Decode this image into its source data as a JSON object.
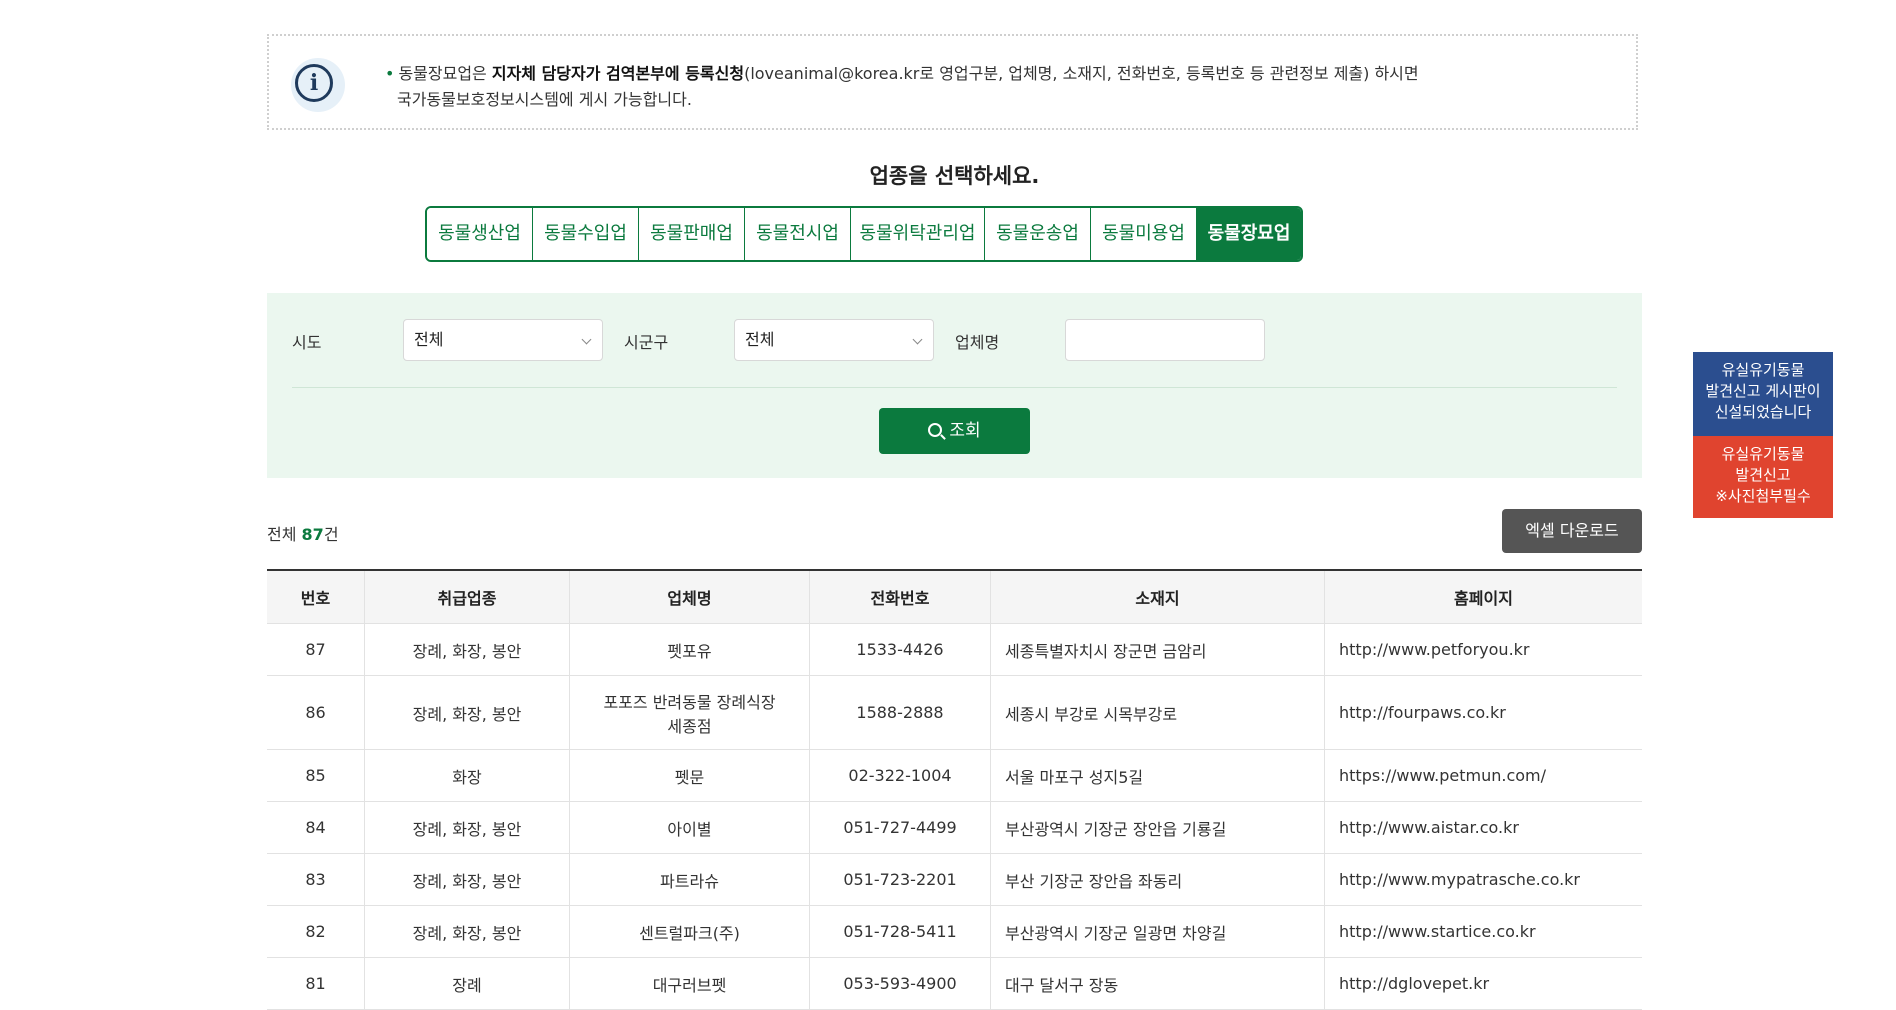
{
  "notice": {
    "bullet": "•",
    "line1_prefix": "동물장묘업은 ",
    "line1_bold": "지자체 담당자가 검역본부에 등록신청",
    "line1_suffix": "(loveanimal@korea.kr로 영업구분, 업체명, 소재지, 전화번호, 등록번호 등 관련정보 제출) 하시면",
    "line2": "국가동물보호정보시스템에 게시 가능합니다.",
    "icon": "info-icon",
    "icon_glyph": "i"
  },
  "select_title": "업종을 선택하세요.",
  "tabs": [
    {
      "label": "동물생산업",
      "active": false
    },
    {
      "label": "동물수입업",
      "active": false
    },
    {
      "label": "동물판매업",
      "active": false
    },
    {
      "label": "동물전시업",
      "active": false
    },
    {
      "label": "동물위탁관리업",
      "active": false
    },
    {
      "label": "동물운송업",
      "active": false
    },
    {
      "label": "동물미용업",
      "active": false
    },
    {
      "label": "동물장묘업",
      "active": true
    }
  ],
  "search": {
    "sido_label": "시도",
    "sido_value": "전체",
    "sigungu_label": "시군구",
    "sigungu_value": "전체",
    "company_label": "업체명",
    "company_value": "",
    "button_label": "조회"
  },
  "count": {
    "prefix": "전체",
    "value": "87",
    "suffix": "건"
  },
  "excel_button": "엑셀 다운로드",
  "table": {
    "headers": [
      "번호",
      "취급업종",
      "업체명",
      "전화번호",
      "소재지",
      "홈페이지"
    ],
    "rows": [
      {
        "no": "87",
        "type": "장례, 화장, 봉안",
        "name1": "펫포유",
        "name2": "",
        "phone": "1533-4426",
        "addr": "세종특별자치시 장군면 금암리",
        "url": "http://www.petforyou.kr"
      },
      {
        "no": "86",
        "type": "장례, 화장, 봉안",
        "name1": "포포즈 반려동물 장례식장",
        "name2": "세종점",
        "phone": "1588-2888",
        "addr": "세종시 부강로 시목부강로",
        "url": "http://fourpaws.co.kr"
      },
      {
        "no": "85",
        "type": "화장",
        "name1": "펫문",
        "name2": "",
        "phone": "02-322-1004",
        "addr": "서울 마포구 성지5길",
        "url": "https://www.petmun.com/"
      },
      {
        "no": "84",
        "type": "장례, 화장, 봉안",
        "name1": "아이별",
        "name2": "",
        "phone": "051-727-4499",
        "addr": "부산광역시 기장군 장안읍 기룡길",
        "url": "http://www.aistar.co.kr"
      },
      {
        "no": "83",
        "type": "장례, 화장, 봉안",
        "name1": "파트라슈",
        "name2": "",
        "phone": "051-723-2201",
        "addr": "부산 기장군 장안읍 좌동리",
        "url": "http://www.mypatrasche.co.kr"
      },
      {
        "no": "82",
        "type": "장례, 화장, 봉안",
        "name1": "센트럴파크(주)",
        "name2": "",
        "phone": "051-728-5411",
        "addr": "부산광역시 기장군 일광면 차양길",
        "url": "http://www.startice.co.kr"
      },
      {
        "no": "81",
        "type": "장례",
        "name1": "대구러브펫",
        "name2": "",
        "phone": "053-593-4900",
        "addr": "대구 달서구 장동",
        "url": "http://dglovepet.kr"
      }
    ]
  },
  "side_banners": [
    {
      "line1": "유실유기동물",
      "line2": "발견신고 게시판이",
      "line3": "신설되었습니다",
      "color": "#2b4e8f"
    },
    {
      "line1": "유실유기동물",
      "line2": "발견신고",
      "line3": "※사진첨부필수",
      "color": "#e0442f"
    }
  ],
  "colors": {
    "primary_green": "#0b7a3e",
    "panel_bg": "#ebf7ef",
    "excel_btn": "#555555"
  }
}
